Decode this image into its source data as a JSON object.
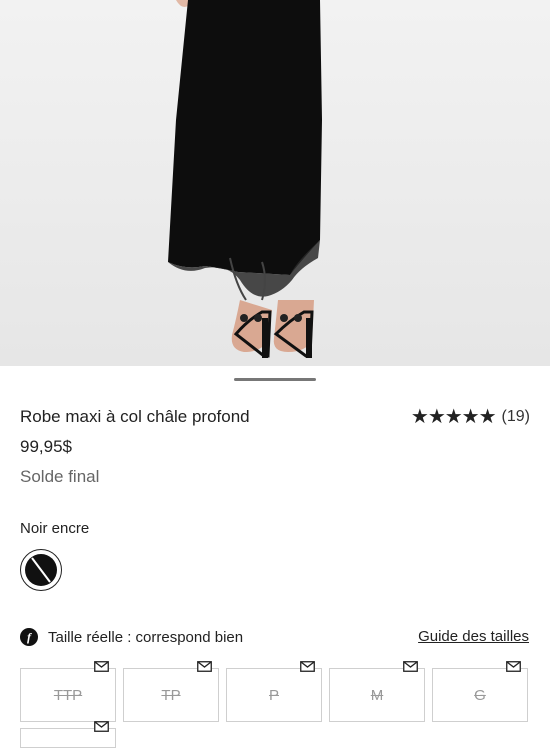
{
  "product": {
    "title": "Robe maxi à col châle profond",
    "price": "99,95$",
    "final_sale": "Solde final",
    "rating": {
      "stars": "★★★★★",
      "count": "(19)",
      "value": 5
    }
  },
  "color": {
    "label": "Noir encre",
    "swatch_color": "#111111"
  },
  "fit": {
    "icon_letter": "f",
    "text": "Taille réelle : correspond bien",
    "guide_link": "Guide des tailles"
  },
  "sizes": [
    {
      "label": "TTP",
      "available": false,
      "notify_icon": "envelope-icon"
    },
    {
      "label": "TP",
      "available": false,
      "notify_icon": "envelope-icon"
    },
    {
      "label": "P",
      "available": false,
      "notify_icon": "envelope-icon"
    },
    {
      "label": "M",
      "available": false,
      "notify_icon": "envelope-icon"
    },
    {
      "label": "G",
      "available": false,
      "notify_icon": "envelope-icon"
    }
  ]
}
